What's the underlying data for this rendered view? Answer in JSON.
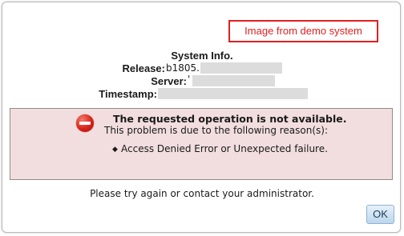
{
  "demo_badge": "Image from demo system",
  "system_info": {
    "title": "System Info.",
    "release_label": "Release:",
    "release_value": "b1805.",
    "server_label": "Server:",
    "server_value": "'",
    "timestamp_label": "Timestamp:"
  },
  "error": {
    "icon": "error-stop-icon",
    "headline": "The requested operation is not available.",
    "subline": "This problem is due to the following reason(s):",
    "bullet_glyph": "◆",
    "reason": "Access Denied Error or Unexpected failure."
  },
  "footer": {
    "message": "Please try again or contact your administrator.",
    "ok_label": "OK"
  },
  "colors": {
    "error_background": "#f2dede",
    "demo_badge": "#e02020",
    "ok_button": "#bcd6ec"
  }
}
